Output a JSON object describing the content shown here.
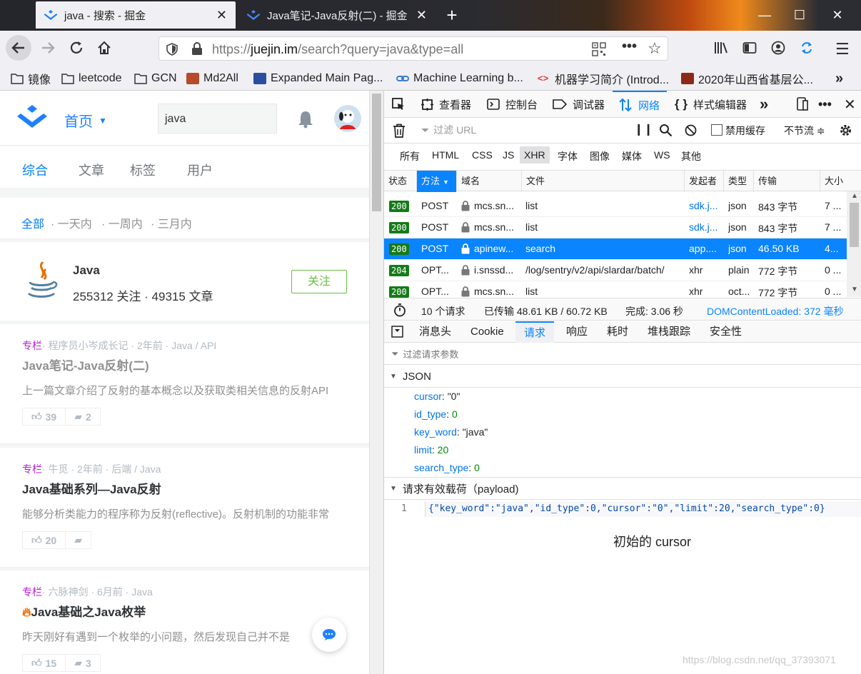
{
  "browser": {
    "tabs": [
      {
        "title": "java - 搜索 - 掘金",
        "active": true
      },
      {
        "title": "Java笔记-Java反射(二) - 掘金",
        "active": false
      }
    ],
    "new_tab": "+",
    "url_prefix": "https://",
    "url_domain": "juejin.im",
    "url_path": "/search?query=java&type=all",
    "bookmarks": [
      "镜像",
      "leetcode",
      "GCN",
      "Md2All",
      "Expanded Main Pag...",
      "Machine Learning b...",
      "机器学习简介 (Introd...",
      "2020年山西省基层公..."
    ]
  },
  "page": {
    "nav_home": "首页",
    "search_value": "java",
    "subnav": [
      "综合",
      "文章",
      "标签",
      "用户"
    ],
    "filters": [
      "全部",
      "一天内",
      "一周内",
      "三月内"
    ],
    "tag": {
      "name": "Java",
      "stats": "255312 关注 · 49315 文章",
      "follow": "关注"
    },
    "articles": [
      {
        "category": "专栏",
        "meta": "· 程序员小岑成长记 · 2年前 · Java / API",
        "title": "Java笔记-Java反射(二)",
        "summary": "上一篇文章介绍了反射的基本概念以及获取类相关信息的反射API",
        "likes": "39",
        "comments": "2",
        "read": true
      },
      {
        "category": "专栏",
        "meta": "· 牛觅 · 2年前 · 后端 / Java",
        "title": "Java基础系列—Java反射",
        "summary": "能够分析类能力的程序称为反射(reflective)。反射机制的功能非常",
        "likes": "20",
        "comments": "",
        "read": false
      },
      {
        "category": "专栏",
        "meta": "· 六脉神剑 · 6月前 · Java",
        "title": "Java基础之Java枚举",
        "summary": "昨天刚好有遇到一个枚举的小问题，然后发现自己并不是",
        "likes": "15",
        "comments": "3",
        "read": false
      }
    ]
  },
  "devtools": {
    "toolbar": [
      "查看器",
      "控制台",
      "调试器",
      "网络",
      "样式编辑器"
    ],
    "filter_placeholder": "过滤 URL",
    "disable_cache": "禁用缓存",
    "throttle": "不节流 ≑",
    "type_filters": [
      "所有",
      "HTML",
      "CSS",
      "JS",
      "XHR",
      "字体",
      "图像",
      "媒体",
      "WS",
      "其他"
    ],
    "columns": [
      "状态",
      "方法",
      "域名",
      "文件",
      "发起者",
      "类型",
      "传输",
      "大小"
    ],
    "requests": [
      {
        "status": "200",
        "method": "POST",
        "domain": "mcs.sn...",
        "file": "list",
        "initiator": "sdk.j...",
        "type": "json",
        "transfer": "843 字节",
        "size": "7 ...",
        "selected": false
      },
      {
        "status": "200",
        "method": "POST",
        "domain": "mcs.sn...",
        "file": "list",
        "initiator": "sdk.j...",
        "type": "json",
        "transfer": "843 字节",
        "size": "7 ...",
        "selected": false
      },
      {
        "status": "200",
        "method": "POST",
        "domain": "apinew...",
        "file": "search",
        "initiator": "app....",
        "type": "json",
        "transfer": "46.50 KB",
        "size": "4...",
        "selected": true
      },
      {
        "status": "204",
        "method": "OPT...",
        "domain": "i.snssd...",
        "file": "/log/sentry/v2/api/slardar/batch/",
        "initiator": "xhr",
        "type": "plain",
        "transfer": "772 字节",
        "size": "0 ...",
        "selected": false
      },
      {
        "status": "200",
        "method": "OPT...",
        "domain": "mcs.sn...",
        "file": "list",
        "initiator": "xhr",
        "type": "oct...",
        "transfer": "772 字节",
        "size": "0 ...",
        "selected": false
      }
    ],
    "summary": {
      "count": "10 个请求",
      "transferred": "已传输 48.61 KB / 60.72 KB",
      "finish": "完成: 3.06 秒",
      "dom": "DOMContentLoaded: 372 毫秒"
    },
    "detail_tabs": [
      "消息头",
      "Cookie",
      "请求",
      "响应",
      "耗时",
      "堆栈跟踪",
      "安全性"
    ],
    "param_filter": "过滤请求参数",
    "json_label": "JSON",
    "json": [
      {
        "k": "cursor",
        "v": "\"0\"",
        "t": "s"
      },
      {
        "k": "id_type",
        "v": "0",
        "t": "n"
      },
      {
        "k": "key_word",
        "v": "\"java\"",
        "t": "s"
      },
      {
        "k": "limit",
        "v": "20",
        "t": "n"
      },
      {
        "k": "search_type",
        "v": "0",
        "t": "n"
      }
    ],
    "payload_label": "请求有效载荷（payload)",
    "payload_line": "1",
    "payload": "{\"key_word\":\"java\",\"id_type\":0,\"cursor\":\"0\",\"limit\":20,\"search_type\":0}",
    "annotation": "初始的 cursor",
    "watermark": "https://blog.csdn.net/qq_37393071"
  },
  "colors": {
    "accent": "#007fff",
    "selected_row": "#0a84ff",
    "status_ok": "#157a1a"
  }
}
